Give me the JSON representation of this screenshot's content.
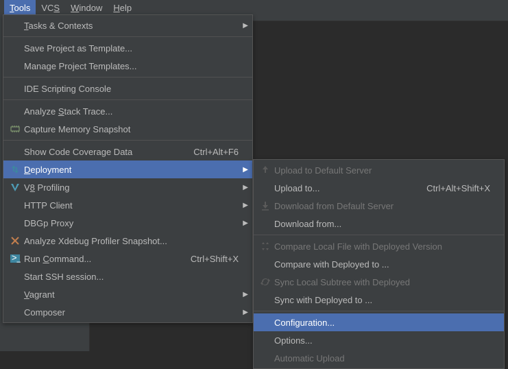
{
  "menubar": {
    "tools": "Tools",
    "vcs": "VCS",
    "window": "Window",
    "help": "Help"
  },
  "tools_menu": {
    "tasks_contexts": "Tasks & Contexts",
    "save_project_template": "Save Project as Template...",
    "manage_project_templates": "Manage Project Templates...",
    "ide_scripting": "IDE Scripting Console",
    "analyze_stack": "Analyze Stack Trace...",
    "capture_memory": "Capture Memory Snapshot",
    "show_coverage": "Show Code Coverage Data",
    "show_coverage_sc": "Ctrl+Alt+F6",
    "deployment": "Deployment",
    "v8_profiling": "V8 Profiling",
    "http_client": "HTTP Client",
    "dbgp_proxy": "DBGp Proxy",
    "analyze_xdebug": "Analyze Xdebug Profiler Snapshot...",
    "run_command": "Run Command...",
    "run_command_sc": "Ctrl+Shift+X",
    "start_ssh": "Start SSH session...",
    "vagrant": "Vagrant",
    "composer": "Composer"
  },
  "deployment_submenu": {
    "upload_default": "Upload to Default Server",
    "upload_to": "Upload to...",
    "upload_to_sc": "Ctrl+Alt+Shift+X",
    "download_default": "Download from Default Server",
    "download_from": "Download from...",
    "compare_local": "Compare Local File with Deployed Version",
    "compare_deployed": "Compare with Deployed to ...",
    "sync_local": "Sync Local Subtree with Deployed",
    "sync_deployed": "Sync with Deployed to ...",
    "configuration": "Configuration...",
    "options": "Options...",
    "automatic_upload": "Automatic Upload"
  }
}
